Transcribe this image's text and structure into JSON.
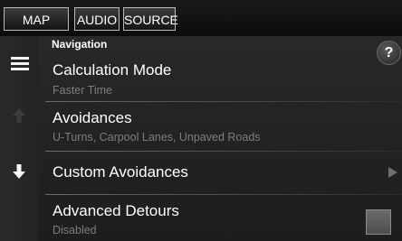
{
  "tabs": {
    "map": "MAP",
    "audio": "AUDIO",
    "source": "SOURCE"
  },
  "section": {
    "title": "Navigation",
    "help_label": "?"
  },
  "items": [
    {
      "label": "Calculation Mode",
      "value": "Faster Time"
    },
    {
      "label": "Avoidances",
      "value": "U-Turns, Carpool Lanes, Unpaved Roads"
    },
    {
      "label": "Custom Avoidances"
    },
    {
      "label": "Advanced Detours",
      "value": "Disabled",
      "checked": false
    }
  ],
  "icons": {
    "menu": "menu-icon",
    "scroll_up": "arrow-up-icon",
    "scroll_down": "arrow-down-icon",
    "submenu": "chevron-right-icon"
  },
  "colors": {
    "text": "#ffffff",
    "subtext": "#7d7d7d",
    "background": "#232323",
    "disabled_arrow": "#3c3c3c"
  }
}
